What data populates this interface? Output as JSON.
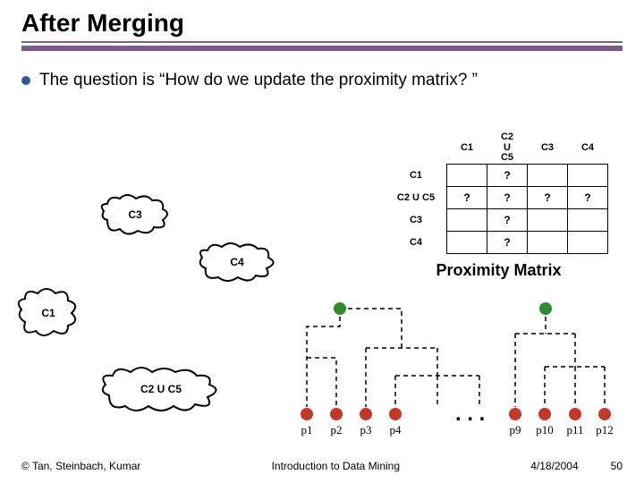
{
  "title": "After Merging",
  "bullet": "The question is “How do we update the proximity matrix? ”",
  "matrix": {
    "col_headers": [
      "C1",
      "C2\nU\nC5",
      "C3",
      "C4"
    ],
    "rows": [
      {
        "label": "C1",
        "cells": [
          "",
          "?",
          "",
          ""
        ]
      },
      {
        "label": "C2 U C5",
        "cells": [
          "?",
          "?",
          "?",
          "?"
        ]
      },
      {
        "label": "C3",
        "cells": [
          "",
          "?",
          "",
          ""
        ]
      },
      {
        "label": "C4",
        "cells": [
          "",
          "?",
          "",
          ""
        ]
      }
    ],
    "caption": "Proximity Matrix"
  },
  "clusters": {
    "c3": "C3",
    "c4": "C4",
    "c1": "C1",
    "c25": "C2 U C5"
  },
  "dendro": {
    "leaves": [
      "p1",
      "p2",
      "p3",
      "p4",
      "p9",
      "p10",
      "p11",
      "p12"
    ],
    "ellipsis": ". . ."
  },
  "footer": {
    "copyright": "© Tan, Steinbach, Kumar",
    "course": "Introduction to Data Mining",
    "date": "4/18/2004",
    "page": "50"
  },
  "chart_data": {
    "type": "table",
    "title": "Proximity Matrix",
    "columns": [
      "C1",
      "C2 U C5",
      "C3",
      "C4"
    ],
    "rows": [
      "C1",
      "C2 U C5",
      "C3",
      "C4"
    ],
    "values": [
      [
        null,
        "?",
        null,
        null
      ],
      [
        "?",
        "?",
        "?",
        "?"
      ],
      [
        null,
        "?",
        null,
        null
      ],
      [
        null,
        "?",
        null,
        null
      ]
    ]
  }
}
